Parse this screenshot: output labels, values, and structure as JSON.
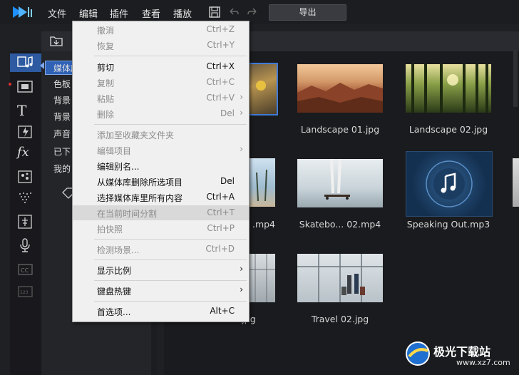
{
  "app": {
    "logo_icon": "app-logo-icon"
  },
  "menubar": {
    "items": [
      "文件",
      "编辑",
      "插件",
      "查看",
      "播放"
    ]
  },
  "toolbar": {
    "export_label": "导出",
    "save_icon": "save-icon",
    "undo_icon": "undo-icon",
    "redo_icon": "redo-icon"
  },
  "sidebar_icons": [
    "media-room-icon",
    "video-overlay-icon",
    "title-icon",
    "transition-icon",
    "fx-icon",
    "pip-icon",
    "particle-icon",
    "chapter-icon",
    "audio-mic-icon",
    "cc-icon",
    "subtitle-icon"
  ],
  "library": {
    "items": [
      "媒体库",
      "色板",
      "背景",
      "背景",
      "声音",
      "已下",
      "我的"
    ],
    "selected": "媒体库"
  },
  "media": {
    "captions": [
      "Landscape 01.jpg",
      "Landscape 02.jpg",
      ".mp4",
      "Skatebo... 02.mp4",
      "Speaking Out.mp3",
      ".jpg",
      "Travel 02.jpg"
    ]
  },
  "context_menu": {
    "items": [
      {
        "label": "撤消",
        "shortcut": "Ctrl+Z",
        "enabled": false
      },
      {
        "label": "恢复",
        "shortcut": "Ctrl+Y",
        "enabled": false
      },
      {
        "label": "剪切",
        "shortcut": "Ctrl+X",
        "enabled": true
      },
      {
        "label": "复制",
        "shortcut": "Ctrl+C",
        "enabled": false
      },
      {
        "label": "粘贴",
        "shortcut": "Ctrl+V",
        "enabled": false,
        "submenu": true
      },
      {
        "label": "删除",
        "shortcut": "Del",
        "enabled": false,
        "submenu": true
      },
      {
        "label": "添加至收藏夹文件夹",
        "shortcut": "",
        "enabled": false
      },
      {
        "label": "编辑项目",
        "shortcut": "",
        "enabled": false,
        "submenu": true
      },
      {
        "label": "编辑别名...",
        "shortcut": "",
        "enabled": true
      },
      {
        "label": "从媒体库删除所选项目",
        "shortcut": "Del",
        "enabled": true
      },
      {
        "label": "选择媒体库里所有内容",
        "shortcut": "Ctrl+A",
        "enabled": true
      },
      {
        "label": "在当前时间分割",
        "shortcut": "Ctrl+T",
        "enabled": false,
        "highlighted": true
      },
      {
        "label": "拍快照",
        "shortcut": "Ctrl+P",
        "enabled": false
      },
      {
        "label": "检测场景...",
        "shortcut": "Ctrl+D",
        "enabled": false
      },
      {
        "label": "显示比例",
        "shortcut": "",
        "enabled": true,
        "submenu": true
      },
      {
        "label": "键盘热键",
        "shortcut": "",
        "enabled": true,
        "submenu": true
      },
      {
        "label": "首选项...",
        "shortcut": "Alt+C",
        "enabled": true
      }
    ]
  },
  "watermark": {
    "text": "极光下载站",
    "url": "www.xz7.com"
  }
}
